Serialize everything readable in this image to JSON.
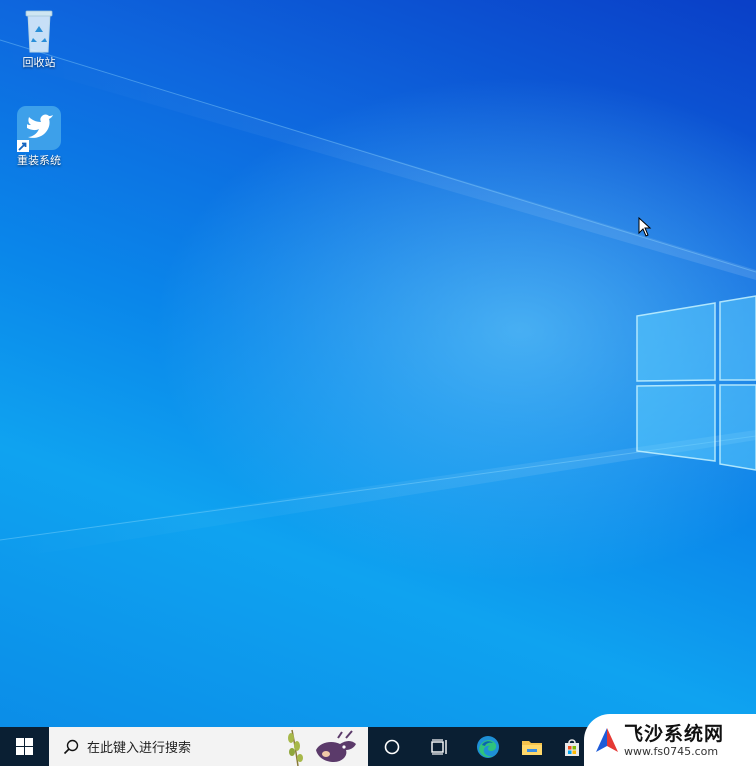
{
  "desktop": {
    "icons": [
      {
        "label": "回收站",
        "icon": "recycle-bin-icon"
      },
      {
        "label": "重装系统",
        "icon": "bird-app-icon"
      }
    ]
  },
  "taskbar": {
    "search_placeholder": "在此键入进行搜索",
    "apps": [
      "start-icon",
      "search-icon",
      "cortana-icon",
      "task-view-icon",
      "edge-icon",
      "file-explorer-icon",
      "store-icon"
    ]
  },
  "watermark": {
    "title": "飞沙系统网",
    "url": "www.fs0745.com"
  },
  "colors": {
    "taskbar": "#0a1f33",
    "desktop_blue": "#0a86ea",
    "search_bg": "#f3f3f3"
  }
}
